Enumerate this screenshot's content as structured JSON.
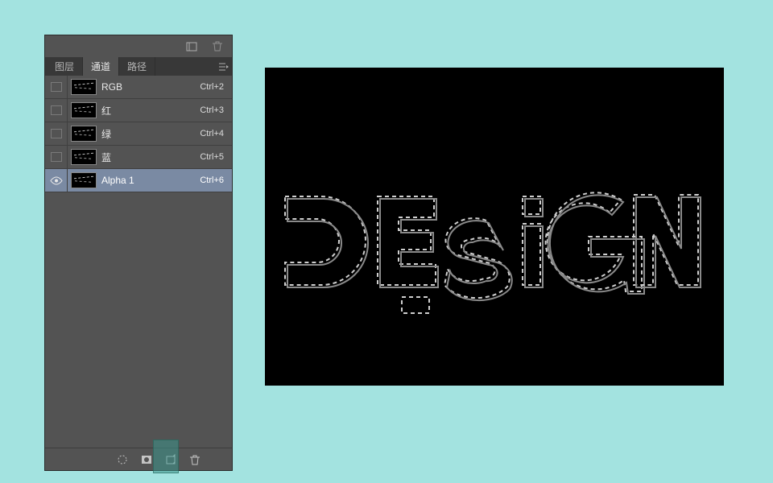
{
  "panel": {
    "tabs": [
      {
        "label": "图层",
        "active": false
      },
      {
        "label": "通道",
        "active": true
      },
      {
        "label": "路径",
        "active": false
      }
    ],
    "channels": [
      {
        "name": "RGB",
        "shortcut": "Ctrl+2",
        "selected": false
      },
      {
        "name": "红",
        "shortcut": "Ctrl+3",
        "selected": false
      },
      {
        "name": "绿",
        "shortcut": "Ctrl+4",
        "selected": false
      },
      {
        "name": "蓝",
        "shortcut": "Ctrl+5",
        "selected": false
      },
      {
        "name": "Alpha 1",
        "shortcut": "Ctrl+6",
        "selected": true
      }
    ],
    "footer_icons": [
      "load-selection",
      "save-selection-mask",
      "new-channel",
      "delete-channel"
    ],
    "footer_highlight_index": 2
  },
  "canvas": {
    "artwork_label": "D E S i G N"
  }
}
